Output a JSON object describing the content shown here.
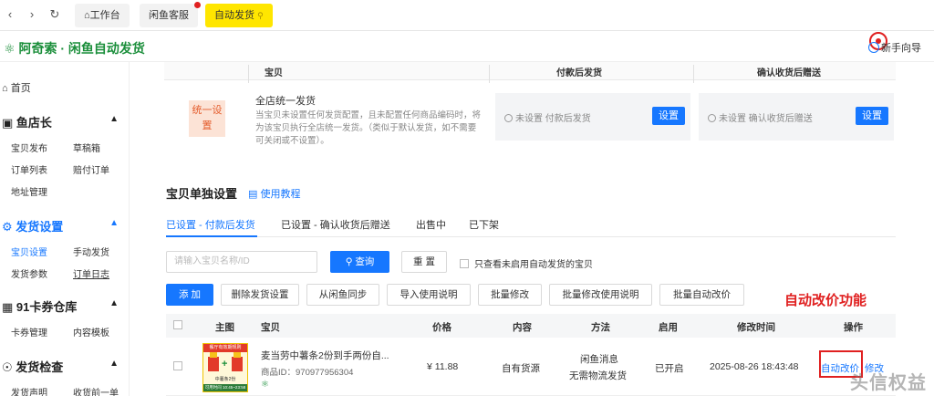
{
  "topbar": {
    "back_icon": "chevron-left-icon",
    "forward_icon": "chevron-right-icon",
    "refresh_icon": "refresh-icon",
    "tabs": [
      {
        "label": "工作台",
        "icon": "home-icon"
      },
      {
        "label": "闲鱼客服"
      },
      {
        "label": "自动发货",
        "icon": "pin-icon"
      }
    ]
  },
  "appbar": {
    "logo_text": "阿奇索 · 闲鱼自动发货",
    "guide_label": "新手向导"
  },
  "sidebar": {
    "home": "首页",
    "groups": [
      {
        "title": "鱼店长",
        "items": [
          "宝贝发布",
          "草稿箱",
          "订单列表",
          "赔付订单",
          "地址管理"
        ]
      },
      {
        "title": "发货设置",
        "items": [
          "宝贝设置",
          "手动发货",
          "发货参数",
          "订单日志"
        ]
      },
      {
        "title": "91卡券仓库",
        "items": [
          "卡券管理",
          "内容模板"
        ]
      },
      {
        "title": "发货检查",
        "items": [
          "发货声明",
          "收货前一单"
        ]
      }
    ]
  },
  "unified": {
    "header": {
      "col1": "宝贝",
      "col2": "付款后发货",
      "col3": "确认收货后赠送"
    },
    "tag": "统一设置",
    "title": "全店统一发货",
    "desc": "当宝贝未设置任何发货配置，且未配置任何商品编码时，将为该宝贝执行全店统一发货。（类似于默认发货，如不需要可关闭或不设置）。",
    "pay_status": "未设置 付款后发货",
    "confirm_status": "未设置 确认收货后赠送",
    "set_label": "设置"
  },
  "section": {
    "title": "宝贝单独设置",
    "help": "使用教程",
    "subtabs": [
      "已设置 - 付款后发货",
      "已设置 - 确认收货后赠送",
      "出售中",
      "已下架"
    ]
  },
  "filters": {
    "search_placeholder": "请输入宝贝名称/ID",
    "search_btn": "查询",
    "reset_btn": "重 置",
    "only_disabled": "只查看未启用自动发货的宝贝"
  },
  "actions": [
    "添 加",
    "删除发货设置",
    "从闲鱼同步",
    "导入使用说明",
    "批量修改",
    "批量修改使用说明",
    "批量自动改价"
  ],
  "annotation": "自动改价功能",
  "table": {
    "headers": [
      "主图",
      "宝贝",
      "价格",
      "内容",
      "方法",
      "启用",
      "修改时间",
      "操作"
    ],
    "rows": [
      {
        "thumb_text_top": "餐厅有效期规则",
        "thumb_text_mid": "中薯条2份",
        "thumb_text_bot": "可用时间 10:45~23:58",
        "title": "麦当劳中薯条2份到手两份自...",
        "item_id": "商品ID：970977956304",
        "price": "¥ 11.88",
        "content": "自有货源",
        "method_line1": "闲鱼消息",
        "method_line2": "无需物流发货",
        "enabled": "已开启",
        "modified": "2025-08-26 18:43:48",
        "op1": "自动改价",
        "op2": "修改"
      }
    ]
  },
  "watermark": "头信权益"
}
